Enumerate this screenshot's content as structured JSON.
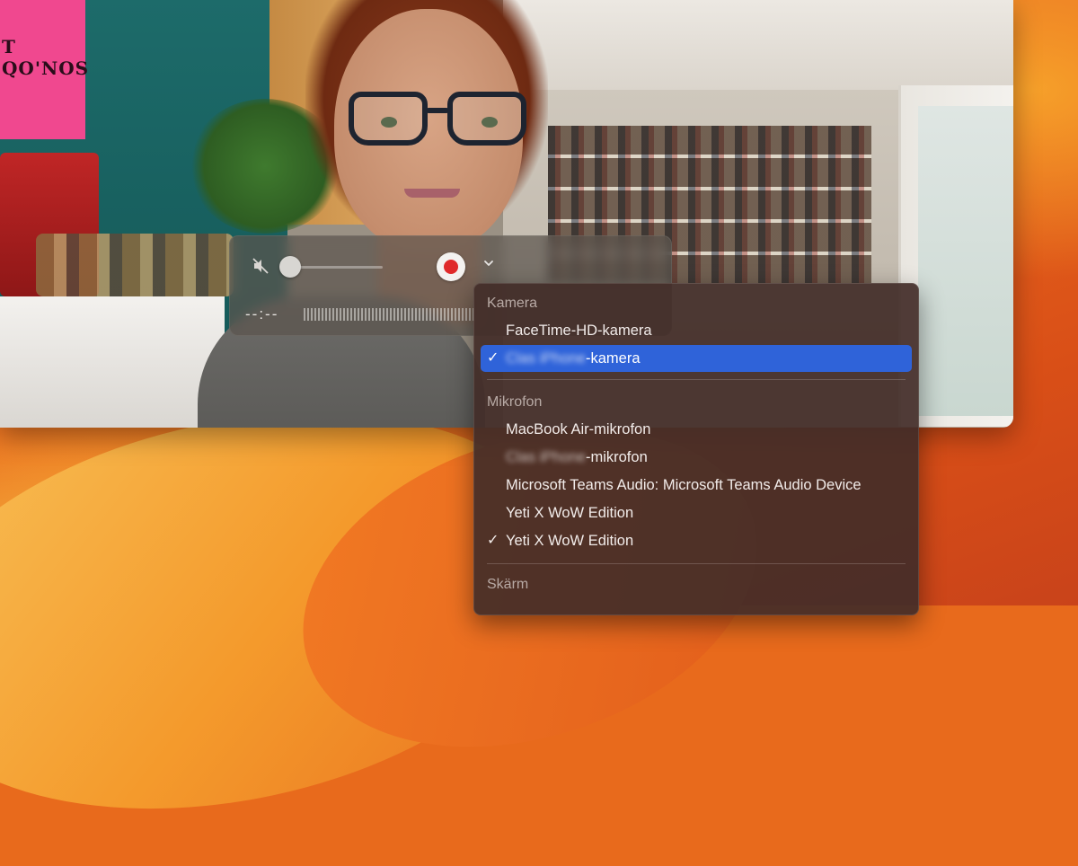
{
  "camera_view": {
    "poster_text": "T QO'NOS"
  },
  "controller": {
    "time": "--:--",
    "mute_icon": "speaker-muted-icon",
    "record_icon": "record-icon",
    "options_icon": "chevron-down-icon",
    "volume_level": 0
  },
  "menu": {
    "camera_header": "Kamera",
    "camera_items": [
      {
        "label": "FaceTime-HD-kamera",
        "checked": false,
        "highlighted": false
      },
      {
        "label_blurred": "Clas iPhone",
        "label_suffix": "-kamera",
        "checked": true,
        "highlighted": true
      }
    ],
    "microphone_header": "Mikrofon",
    "microphone_items": [
      {
        "label": "MacBook Air-mikrofon",
        "checked": false
      },
      {
        "label_blurred": "Clas iPhone",
        "label_suffix": "-mikrofon",
        "checked": false
      },
      {
        "label": "Microsoft Teams Audio: Microsoft Teams Audio Device",
        "checked": false
      },
      {
        "label": "Yeti X WoW Edition",
        "checked": false
      },
      {
        "label": "Yeti X WoW Edition",
        "checked": true
      }
    ],
    "screen_header": "Skärm",
    "check_mark": "✓"
  }
}
